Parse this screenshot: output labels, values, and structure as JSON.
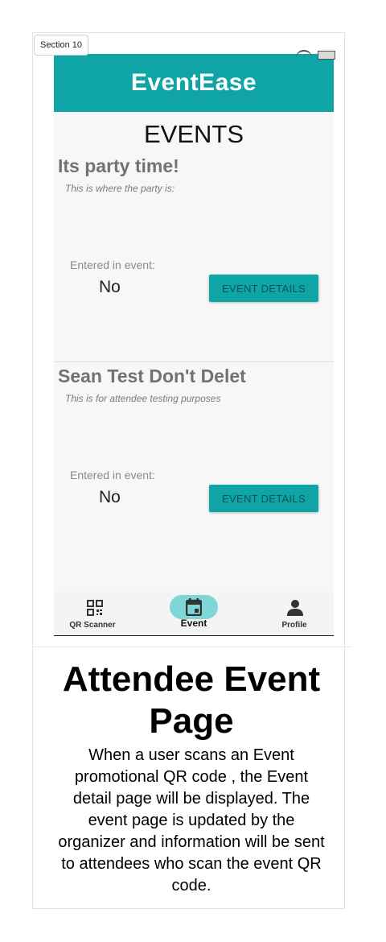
{
  "section_tag": "Section 10",
  "app": {
    "title": "EventEase",
    "page_heading": "EVENTS"
  },
  "events": [
    {
      "title": "Its party time!",
      "description": "This is where the party is:",
      "entered_label": "Entered in event:",
      "entered_value": "No",
      "button_label": "EVENT DETAILS"
    },
    {
      "title": "Sean Test Don't Delet",
      "description": "This is for attendee testing purposes",
      "entered_label": "Entered in event:",
      "entered_value": "No",
      "button_label": "EVENT DETAILS"
    }
  ],
  "bottom_nav": {
    "items": [
      {
        "label": "QR Scanner",
        "icon": "qr-code-icon"
      },
      {
        "label": "Event",
        "icon": "calendar-icon",
        "selected": true
      },
      {
        "label": "Profile",
        "icon": "person-icon"
      }
    ]
  },
  "caption": {
    "title": "Attendee Event Page",
    "body": "When a user scans an Event promotional QR code , the Event detail page will be displayed. The event page is updated by the organizer and information will be sent to attendees who scan the event QR code."
  },
  "colors": {
    "accent": "#0fa5a7",
    "nav_pill": "#7fd6d6"
  }
}
